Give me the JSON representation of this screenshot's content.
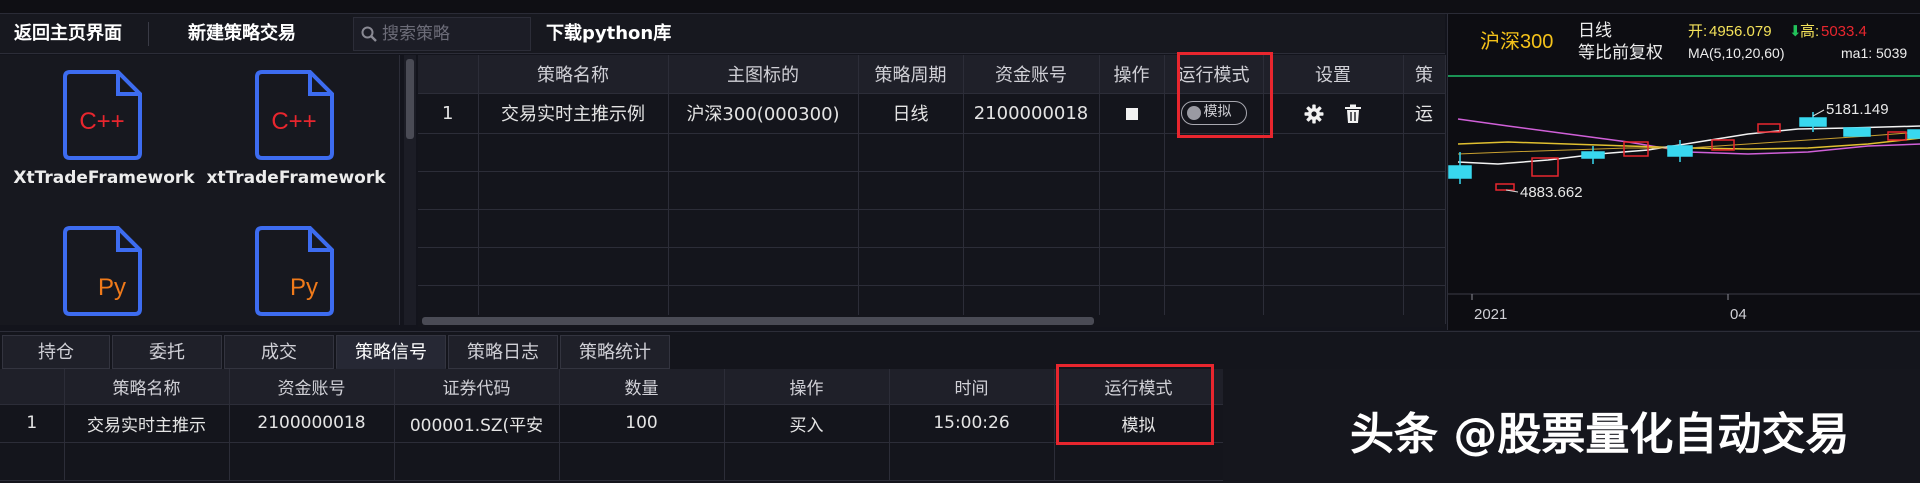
{
  "toolbar": {
    "home_label": "返回主页界面",
    "new_strategy_label": "新建策略交易",
    "search_placeholder": "搜索策略",
    "download_label": "下载python库"
  },
  "strategy_files": [
    {
      "lang": "C++",
      "name": "XtTradeFramework",
      "color": "#e8262e"
    },
    {
      "lang": "C++",
      "name": "xtTradeFramework",
      "color": "#e8262e"
    },
    {
      "lang": "Py",
      "name": "",
      "color": "#f07a1a"
    },
    {
      "lang": "Py",
      "name": "",
      "color": "#f07a1a"
    }
  ],
  "top_table": {
    "headers": [
      "",
      "策略名称",
      "主图标的",
      "策略周期",
      "资金账号",
      "操作",
      "运行模式",
      "设置",
      "策"
    ],
    "rows": [
      {
        "index": "1",
        "name": "交易实时主推示例",
        "symbol": "沪深300(000300)",
        "period": "日线",
        "account": "2100000018",
        "mode": "模拟",
        "status": "运"
      }
    ]
  },
  "chart": {
    "symbol": "沪深300",
    "period": "日线",
    "adjust": "等比前复权",
    "open_label": "开:",
    "open_value": "4956.079",
    "high_label": "高:",
    "high_value": "5033.4",
    "ma_label": "MA(5,10,20,60)",
    "ma1_label": "ma1:",
    "ma1_value": "5039",
    "high_mark": "5181.149",
    "low_mark": "4883.662",
    "x_ticks": [
      "2021",
      "04"
    ],
    "colors": {
      "symbol": "#f4c21a",
      "open": "#f4e25a",
      "down": "#22c25a",
      "candle_up": "#e8262e",
      "candle_down": "#38d8ef"
    }
  },
  "tabs": [
    "持仓",
    "委托",
    "成交",
    "策略信号",
    "策略日志",
    "策略统计"
  ],
  "active_tab": 3,
  "bottom_table": {
    "headers": [
      "",
      "策略名称",
      "资金账号",
      "证券代码",
      "数量",
      "操作",
      "时间",
      "运行模式"
    ],
    "rows": [
      {
        "index": "1",
        "name": "交易实时主推示",
        "account": "2100000018",
        "code": "000001.SZ(平安",
        "qty": "100",
        "action": "买入",
        "time": "15:00:26",
        "mode": "模拟"
      }
    ]
  },
  "watermark": "头条 @股票量化自动交易"
}
